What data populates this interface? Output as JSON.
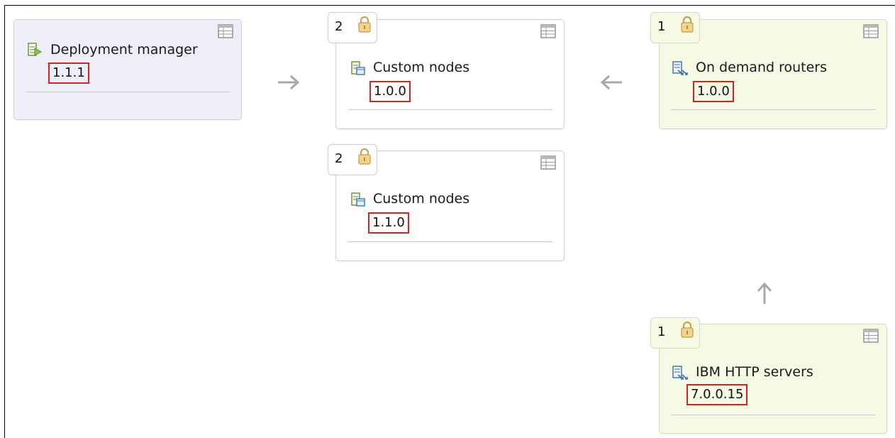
{
  "cards": [
    {
      "id": "deployment-manager",
      "title": "Deployment manager",
      "version": "1.1.1"
    },
    {
      "id": "custom-nodes-1",
      "count": "2",
      "title": "Custom nodes",
      "version": "1.0.0"
    },
    {
      "id": "custom-nodes-2",
      "count": "2",
      "title": "Custom nodes",
      "version": "1.1.0"
    },
    {
      "id": "on-demand-routers",
      "count": "1",
      "title": "On demand routers",
      "version": "1.0.0"
    },
    {
      "id": "ibm-http-servers",
      "count": "1",
      "title": "IBM HTTP servers",
      "version": "7.0.0.15"
    }
  ],
  "colors": {
    "highlight_border": "#e21d1d",
    "deployment_manager_bg": "#eeeef9",
    "edge_group_bg": "#f4fae4",
    "arrow": "#a8a8a8"
  },
  "icons": {
    "table": "table-view-icon",
    "lock": "lock-icon",
    "deployment_manager": "deployment-manager-icon",
    "custom_nodes": "custom-node-icon",
    "router": "router-icon",
    "web_server": "web-server-icon"
  }
}
